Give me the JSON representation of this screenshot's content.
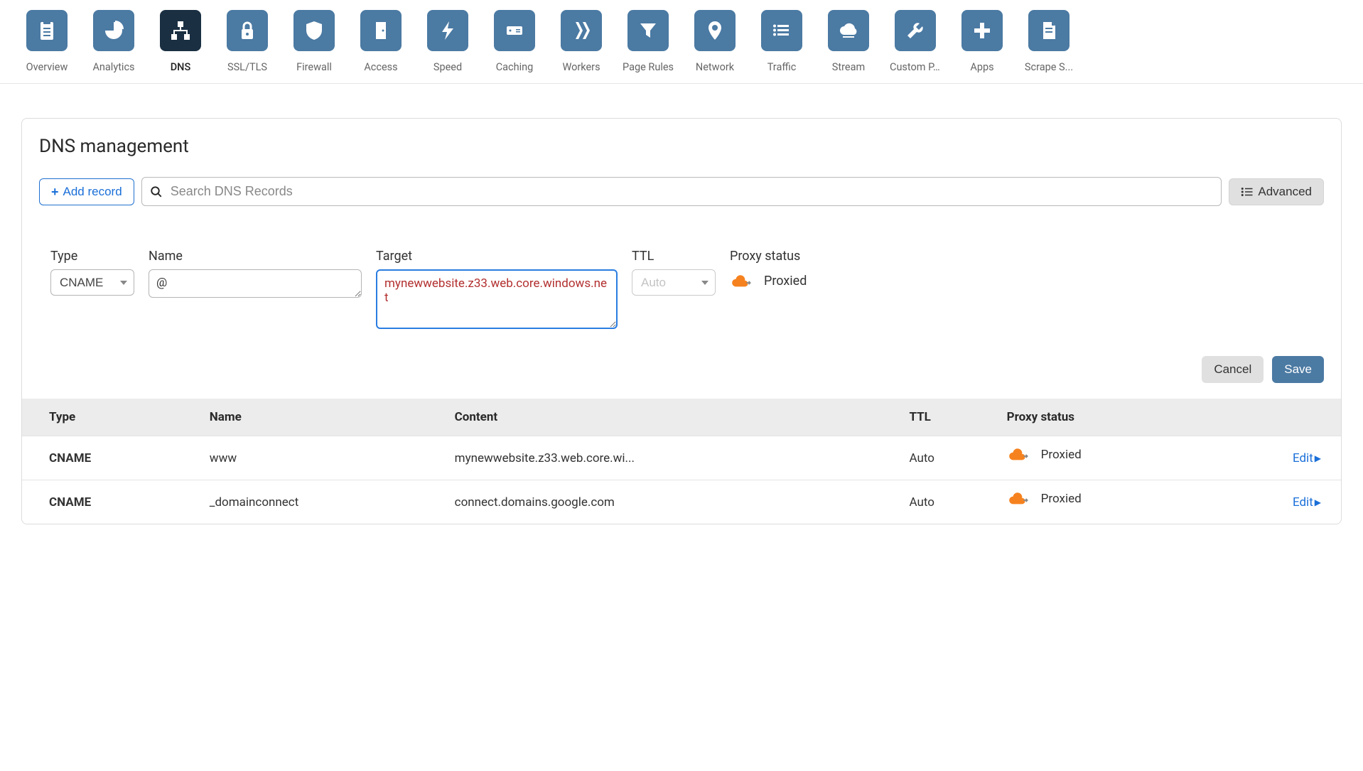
{
  "nav": [
    {
      "key": "overview",
      "label": "Overview",
      "active": false,
      "icon": "clipboard"
    },
    {
      "key": "analytics",
      "label": "Analytics",
      "active": false,
      "icon": "pie"
    },
    {
      "key": "dns",
      "label": "DNS",
      "active": true,
      "icon": "sitemap"
    },
    {
      "key": "ssl",
      "label": "SSL/TLS",
      "active": false,
      "icon": "lock"
    },
    {
      "key": "firewall",
      "label": "Firewall",
      "active": false,
      "icon": "shield"
    },
    {
      "key": "access",
      "label": "Access",
      "active": false,
      "icon": "door"
    },
    {
      "key": "speed",
      "label": "Speed",
      "active": false,
      "icon": "bolt"
    },
    {
      "key": "caching",
      "label": "Caching",
      "active": false,
      "icon": "drive"
    },
    {
      "key": "workers",
      "label": "Workers",
      "active": false,
      "icon": "workers"
    },
    {
      "key": "pagerules",
      "label": "Page Rules",
      "active": false,
      "icon": "funnel"
    },
    {
      "key": "network",
      "label": "Network",
      "active": false,
      "icon": "pin"
    },
    {
      "key": "traffic",
      "label": "Traffic",
      "active": false,
      "icon": "list"
    },
    {
      "key": "stream",
      "label": "Stream",
      "active": false,
      "icon": "cloud"
    },
    {
      "key": "custompages",
      "label": "Custom P...",
      "active": false,
      "icon": "wrench"
    },
    {
      "key": "apps",
      "label": "Apps",
      "active": false,
      "icon": "plus"
    },
    {
      "key": "scrape",
      "label": "Scrape S...",
      "active": false,
      "icon": "doc"
    }
  ],
  "panel": {
    "title": "DNS management",
    "add_record": "Add record",
    "search_placeholder": "Search DNS Records",
    "advanced": "Advanced",
    "form": {
      "type_label": "Type",
      "type_value": "CNAME",
      "name_label": "Name",
      "name_value": "@",
      "target_label": "Target",
      "target_value": "mynewwebsite.z33.web.core.windows.net",
      "ttl_label": "TTL",
      "ttl_value": "Auto",
      "proxy_label": "Proxy status",
      "proxy_value": "Proxied"
    },
    "cancel": "Cancel",
    "save": "Save",
    "columns": {
      "type": "Type",
      "name": "Name",
      "content": "Content",
      "ttl": "TTL",
      "proxy": "Proxy status"
    },
    "edit_label": "Edit",
    "rows": [
      {
        "type": "CNAME",
        "name": "www",
        "content": "mynewwebsite.z33.web.core.wi...",
        "ttl": "Auto",
        "proxy": "Proxied"
      },
      {
        "type": "CNAME",
        "name": "_domainconnect",
        "content": "connect.domains.google.com",
        "ttl": "Auto",
        "proxy": "Proxied"
      }
    ]
  }
}
